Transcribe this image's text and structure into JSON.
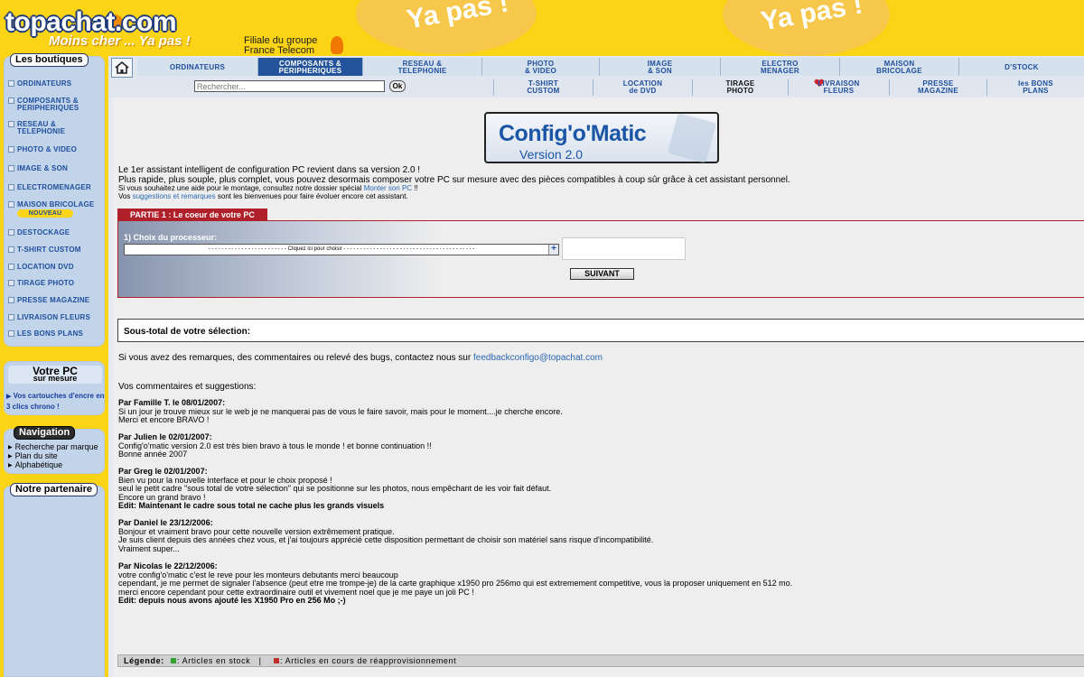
{
  "header": {
    "logo": "topachat.com",
    "slogan": "Moins cher ... Ya pas !",
    "filiale_line1": "Filiale du groupe",
    "filiale_line2": "France Telecom",
    "bubble_text": "Moins cher ... Ya pas !"
  },
  "sidebar": {
    "boutiques_title": "Les boutiques",
    "items": [
      {
        "label": "ORDINATEURS"
      },
      {
        "label": "COMPOSANTS &",
        "label2": "PERIPHERIQUES"
      },
      {
        "label": "RESEAU &",
        "label2": "TELEPHONIE"
      },
      {
        "label": "PHOTO & VIDEO"
      },
      {
        "label": "IMAGE & SON"
      },
      {
        "label": "ELECTROMENAGER"
      },
      {
        "label": "MAISON BRICOLAGE",
        "badge": "NOUVEAU"
      },
      {
        "label": "DESTOCKAGE"
      },
      {
        "label": "T-SHIRT CUSTOM"
      },
      {
        "label": "LOCATION DVD"
      },
      {
        "label": "TIRAGE PHOTO"
      },
      {
        "label": "PRESSE MAGAZINE"
      },
      {
        "label": "LIVRAISON FLEURS"
      },
      {
        "label": "LES BONS PLANS"
      }
    ],
    "votrepc_title1": "Votre PC",
    "votrepc_title2": "sur mesure",
    "votrepc_text": "Vos cartouches d'encre en 3 clics chrono !",
    "navigation_title": "Navigation",
    "nav_links": [
      "Recherche par marque",
      "Plan du site",
      "Alphabétique"
    ],
    "partenaire_title": "Notre partenaire"
  },
  "topnav": {
    "categories": [
      {
        "l1": "ORDINATEURS",
        "l2": ""
      },
      {
        "l1": "COMPOSANTS &",
        "l2": "PERIPHERIQUES"
      },
      {
        "l1": "RESEAU &",
        "l2": "TELEPHONIE"
      },
      {
        "l1": "PHOTO",
        "l2": "& VIDEO"
      },
      {
        "l1": "IMAGE",
        "l2": "& SON"
      },
      {
        "l1": "ELECTRO",
        "l2": "MENAGER"
      },
      {
        "l1": "MAISON",
        "l2": "BRICOLAGE"
      },
      {
        "l1": "D'STOCK",
        "l2": ""
      }
    ],
    "subs": [
      {
        "l1": "T-SHIRT",
        "l2": "CUSTOM"
      },
      {
        "l1": "LOCATION",
        "l2": "de DVD"
      },
      {
        "l1": "TIRAGE",
        "l2": "PHOTO"
      },
      {
        "l1": "LIVRAISON",
        "l2": "FLEURS"
      },
      {
        "l1": "PRESSE",
        "l2": "MAGAZINE"
      },
      {
        "l1": "les BONS",
        "l2": "PLANS"
      }
    ],
    "search_placeholder": "Rechercher...",
    "search_ok": "Ok"
  },
  "main": {
    "logo_name": "Config'o'Matic",
    "logo_version": "Version 2.0",
    "intro1": "Le 1er assistant intelligent de configuration PC revient dans sa version 2.0 !",
    "intro2": "Plus rapide, plus souple, plus complet, vous pouvez desormais composer votre PC sur mesure avec des pièces compatibles à coup sûr grâce à cet assistant personnel.",
    "intro3_pre": "Si vous souhaitez une aide pour le montage, consultez notre dossier spécial ",
    "intro3_link": "Monter son PC",
    "intro3_post": " !!",
    "intro4_pre": "Vos ",
    "intro4_link": "suggestions et remarques",
    "intro4_post": " sont les bienvenues pour faire évoluer encore cet assistant.",
    "partie_tab": "PARTIE 1 : Le coeur de votre PC",
    "choix_label": "1) Choix du processeur:",
    "select_text": "- - - - - - - - - - - - - - - - - - - - - - - - Cliquez ici pour choisir - - - - - - - - - - - - - - - - - - - - - - - - - - - - - - - - - - - - - - - -",
    "suivant": "SUIVANT",
    "soustotal": "Sous-total de votre sélection:",
    "feedback_pre": "Si vous avez des remarques, des commentaires ou relevé des bugs, contactez nous sur ",
    "feedback_link": "feedbackconfigo@topachat.com",
    "comments_title": "Vos commentaires et suggestions:",
    "comments": [
      {
        "by": "Par Famille T. le 08/01/2007:",
        "lines": [
          "Si un jour je trouve mieux sur le web je ne manquerai pas de vous le faire savoir, mais pour le moment....je cherche encore.",
          "Merci et encore BRAVO !"
        ],
        "edit": ""
      },
      {
        "by": "Par Julien le 02/01/2007:",
        "lines": [
          "Config'o'matic version 2.0 est très bien bravo à tous le monde ! et bonne continuation !!",
          "Bonne année 2007"
        ],
        "edit": ""
      },
      {
        "by": "Par Greg le 02/01/2007:",
        "lines": [
          "Bien vu pour la nouvelle interface et pour le choix proposé !",
          "seul le petit cadre \"sous total de votre sélection\" qui se positionne sur les photos, nous empêchant de les voir fait défaut.",
          "Encore un grand bravo !"
        ],
        "edit": "Edit: Maintenant le cadre sous total ne cache plus les grands visuels"
      },
      {
        "by": "Par Daniel le 23/12/2006:",
        "lines": [
          "Bonjour et vraiment bravo pour cette nouvelle version extrêmement pratique.",
          "Je suis client depuis des années chez vous, et j'ai toujours apprécié cette disposition permettant de choisir son matériel sans risque d'incompatibilité.",
          "Vraiment super..."
        ],
        "edit": ""
      },
      {
        "by": "Par Nicolas le 22/12/2006:",
        "lines": [
          "votre config'o'matic c'est le reve pour les monteurs debutants merci beaucoup",
          "cependant, je me permet de signaler l'absence (peut etre me trompe-je) de la carte graphique x1950 pro 256mo qui est extremement competitive, vous la proposer uniquement en 512 mo.",
          "merci encore cependant pour cette extraordinaire outil et vivement noel que je me paye un joli PC !"
        ],
        "edit": "Edit: depuis nous avons ajouté les X1950 Pro en 256 Mo ;-)"
      }
    ],
    "legend_label": "Légende:",
    "legend_stock": ": Articles en stock",
    "legend_sep": "|",
    "legend_restock": ": Articles en cours de réapprovisionnement",
    "colors": {
      "stock": "#2fa52f",
      "restock": "#c0302a"
    }
  }
}
